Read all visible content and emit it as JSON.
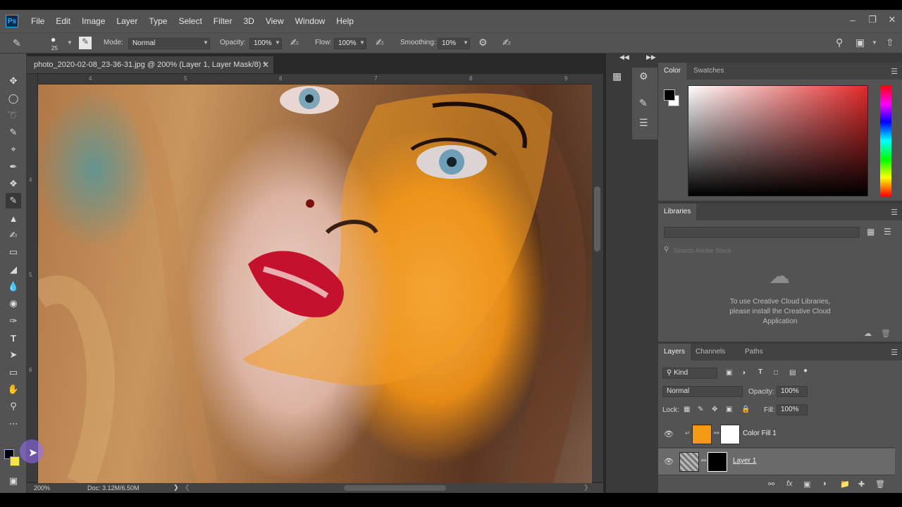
{
  "app": {
    "menu": [
      "File",
      "Edit",
      "Image",
      "Layer",
      "Type",
      "Select",
      "Filter",
      "3D",
      "View",
      "Window",
      "Help"
    ],
    "logo": "Ps"
  },
  "options": {
    "brush_size": "25",
    "mode_label": "Mode:",
    "mode_value": "Normal",
    "opacity_label": "Opacity:",
    "opacity_value": "100%",
    "flow_label": "Flow:",
    "flow_value": "100%",
    "smoothing_label": "Smoothing:",
    "smoothing_value": "10%"
  },
  "document": {
    "tab_title": "photo_2020-02-08_23-36-31.jpg @ 200% (Layer 1, Layer Mask/8) *",
    "ruler_h": [
      "4",
      "5",
      "6",
      "7",
      "8",
      "9"
    ],
    "ruler_v": [
      "4",
      "5",
      "6"
    ],
    "zoom": "200%",
    "doc_info": "Doc: 3.12M/6.50M"
  },
  "panels": {
    "color_tabs": [
      "Color",
      "Swatches"
    ],
    "libraries_title": "Libraries",
    "libraries_search_placeholder": "Search Adobe Stock",
    "libraries_message": "To use Creative Cloud Libraries, please install the Creative Cloud Application",
    "layers_tabs": [
      "Layers",
      "Channels",
      "Paths"
    ],
    "kind_label": "Kind",
    "blend_mode": "Normal",
    "opacity_label": "Opacity:",
    "opacity_value": "100%",
    "lock_label": "Lock:",
    "fill_label": "Fill:",
    "fill_value": "100%",
    "layers": [
      {
        "name": "Color Fill 1",
        "fill_color": "#f59a12"
      },
      {
        "name": "Layer 1"
      }
    ]
  },
  "colors": {
    "foreground": "#000000",
    "background": "#ffffff",
    "fill_swatch": "#f59a12"
  }
}
